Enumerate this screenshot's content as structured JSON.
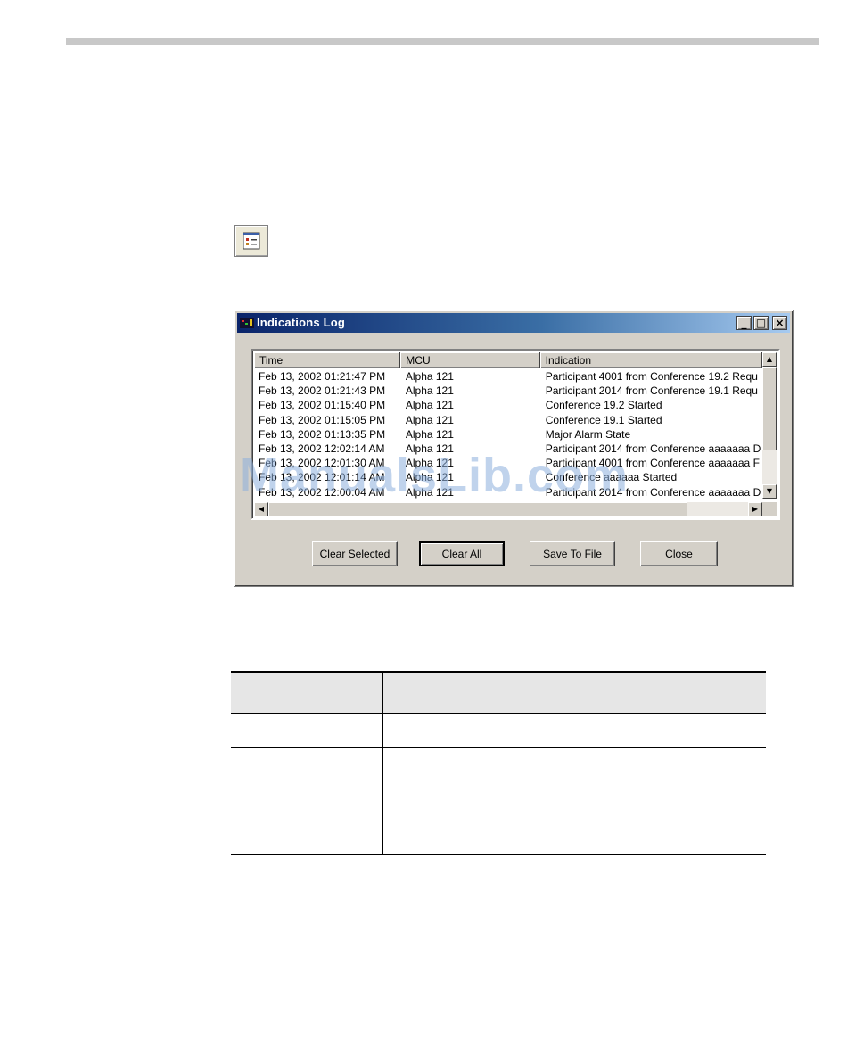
{
  "dialog": {
    "title": "Indications Log",
    "window_buttons": {
      "minimize": "_",
      "maximize": "□",
      "close": "×"
    },
    "columns": [
      "Time",
      "MCU",
      "Indication"
    ],
    "rows": [
      [
        "Feb 13, 2002  01:21:47 PM",
        "Alpha 121",
        "Participant 4001 from Conference 19.2 Requ"
      ],
      [
        "Feb 13, 2002  01:21:43 PM",
        "Alpha 121",
        "Participant 2014 from Conference 19.1 Requ"
      ],
      [
        "Feb 13, 2002  01:15:40 PM",
        "Alpha 121",
        "Conference 19.2 Started"
      ],
      [
        "Feb 13, 2002  01:15:05 PM",
        "Alpha 121",
        "Conference 19.1 Started"
      ],
      [
        "Feb 13, 2002  01:13:35 PM",
        "Alpha 121",
        "Major Alarm State"
      ],
      [
        "Feb 13, 2002  12:02:14 AM",
        "Alpha 121",
        "Participant 2014 from Conference aaaaaaa D"
      ],
      [
        "Feb 13, 2002  12:01:30 AM",
        "Alpha 121",
        "Participant 4001 from Conference aaaaaaa F"
      ],
      [
        "Feb 13, 2002  12:01:14 AM",
        "Alpha 121",
        "Conference aaaaaa Started"
      ],
      [
        "Feb 13, 2002  12:00:04 AM",
        "Alpha 121",
        "Participant 2014 from Conference aaaaaaa D"
      ]
    ],
    "buttons": {
      "clear_selected": "Clear Selected",
      "clear_all": "Clear All",
      "save_to_file": "Save To File",
      "close": "Close"
    }
  },
  "watermark": "ManualsLib.com"
}
